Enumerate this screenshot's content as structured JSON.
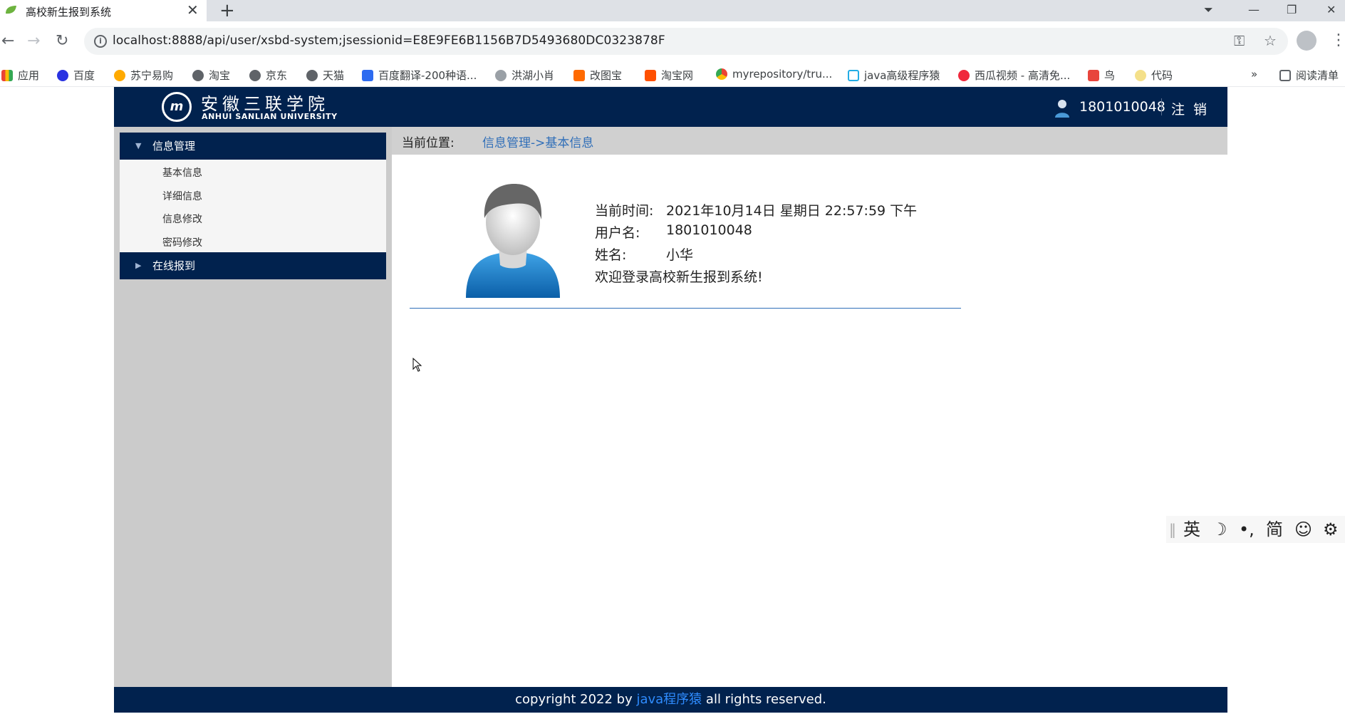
{
  "browser": {
    "tab_title": "高校新生报到系统",
    "url": "localhost:8888/api/user/xsbd-system;jsessionid=E8E9FE6B1156B7D5493680DC0323878F",
    "bookmarks": [
      "应用",
      "百度",
      "苏宁易购",
      "淘宝",
      "京东",
      "天猫",
      "百度翻译-200种语...",
      "洪湖小肖",
      "改图宝",
      "淘宝网",
      "myrepository/tru...",
      "java高级程序猿",
      "西瓜视频 - 高清免...",
      "鸟",
      "代码"
    ],
    "overflow": "»",
    "reading_list": "阅读清单"
  },
  "header": {
    "logo_cn": "安徽三联学院",
    "logo_en": "ANHUI SANLIAN UNIVERSITY",
    "username": "1801010048",
    "logout": "注销"
  },
  "sidebar": {
    "group1": "信息管理",
    "items": [
      "基本信息",
      "详细信息",
      "信息修改",
      "密码修改"
    ],
    "group2": "在线报到"
  },
  "breadcrumb": {
    "label": "当前位置:",
    "path": "信息管理->基本信息"
  },
  "profile": {
    "time_label": "当前时间:",
    "time_value": "2021年10月14日 星期日 22:57:59 下午",
    "username_label": "用户名:",
    "username_value": "1801010048",
    "name_label": "姓名:",
    "name_value": "小华",
    "welcome": "欢迎登录高校新生报到系统!"
  },
  "footer": {
    "prefix": "copyright 2022 by ",
    "author": "java程序猿",
    "suffix": " all rights reserved."
  },
  "ime": {
    "lang": "英",
    "simplified": "简"
  },
  "colors": {
    "navy": "#01224e",
    "link_blue": "#2f6eb8",
    "sidebar_gray": "#cbcbcb"
  }
}
